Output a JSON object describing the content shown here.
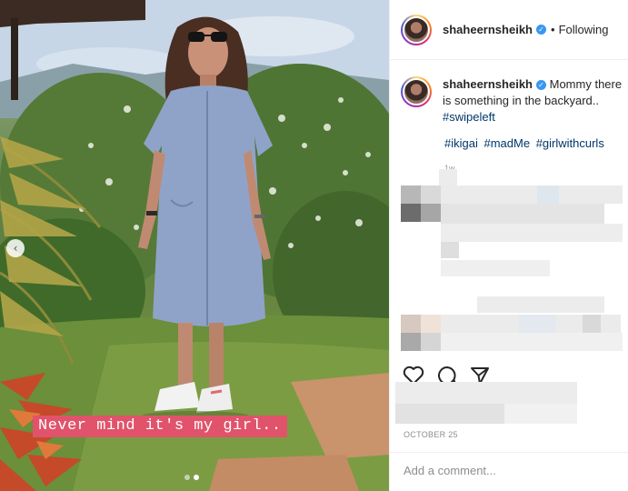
{
  "post": {
    "username": "shaheernsheikh",
    "follow_separator": "•",
    "follow_status": "Following",
    "caption_text": "Mommy there is something in the backyard..",
    "caption_hashtag": "#swipeleft",
    "hashtags": [
      "#ikigai",
      "#madMe",
      "#girlwithcurls"
    ],
    "comment_time": "1w",
    "date": "OCTOBER 25",
    "add_comment_placeholder": "Add a comment..."
  },
  "media": {
    "overlay_caption": "Never mind it's my girl..",
    "carousel_dots": 2,
    "active_dot": 1
  },
  "icons": {
    "verified": "verified-badge-icon",
    "like": "heart-icon",
    "comment": "speech-bubble-icon",
    "share": "paper-plane-icon",
    "carousel_prev": "chevron-left-icon"
  },
  "colors": {
    "banner": "#e0536b",
    "verified": "#3897f0",
    "hashtag": "#00376b",
    "muted": "#8e8e8e"
  }
}
